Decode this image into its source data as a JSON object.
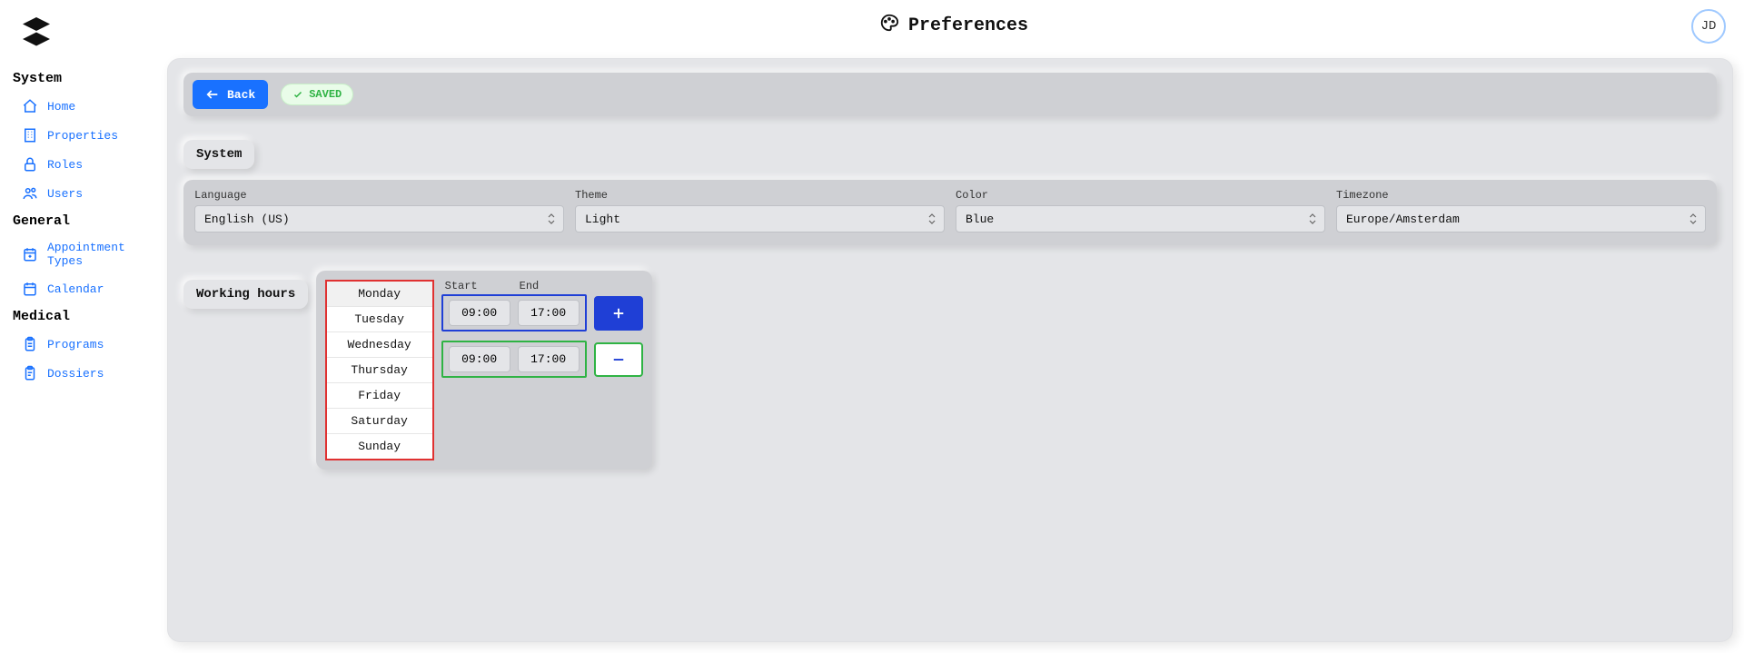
{
  "header": {
    "title": "Preferences"
  },
  "avatar": {
    "initials": "JD"
  },
  "sidebar": {
    "sections": [
      {
        "title": "System",
        "items": [
          {
            "label": "Home"
          },
          {
            "label": "Properties"
          },
          {
            "label": "Roles"
          },
          {
            "label": "Users"
          }
        ]
      },
      {
        "title": "General",
        "items": [
          {
            "label": "Appointment Types"
          },
          {
            "label": "Calendar"
          }
        ]
      },
      {
        "title": "Medical",
        "items": [
          {
            "label": "Programs"
          },
          {
            "label": "Dossiers"
          }
        ]
      }
    ]
  },
  "toolbar": {
    "back_label": "Back",
    "saved_badge": "SAVED"
  },
  "sections": {
    "system": {
      "title": "System",
      "fields": {
        "language": {
          "label": "Language",
          "value": "English (US)"
        },
        "theme": {
          "label": "Theme",
          "value": "Light"
        },
        "color": {
          "label": "Color",
          "value": "Blue"
        },
        "timezone": {
          "label": "Timezone",
          "value": "Europe/Amsterdam"
        }
      }
    },
    "working_hours": {
      "title": "Working hours",
      "start_label": "Start",
      "end_label": "End",
      "days": [
        "Monday",
        "Tuesday",
        "Wednesday",
        "Thursday",
        "Friday",
        "Saturday",
        "Sunday"
      ],
      "active_day_index": 0,
      "rows": [
        {
          "start": "09:00",
          "end": "17:00"
        },
        {
          "start": "09:00",
          "end": "17:00"
        }
      ]
    }
  }
}
